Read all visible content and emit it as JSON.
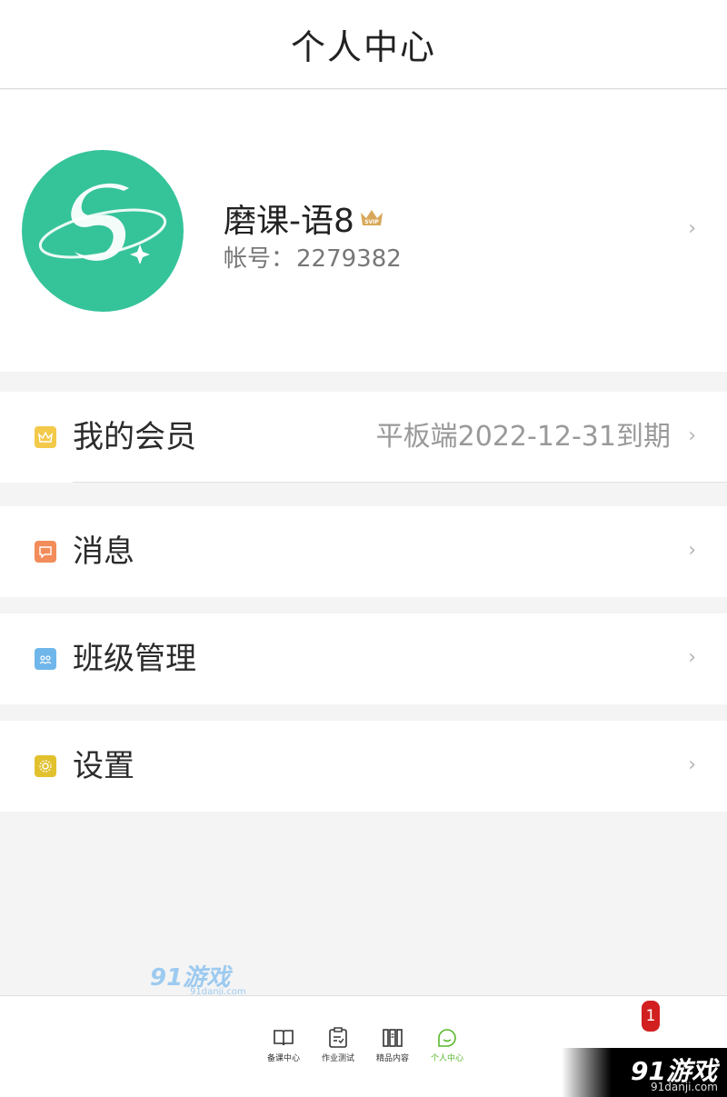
{
  "header": {
    "title": "个人中心"
  },
  "profile": {
    "name": "磨课-语8",
    "vip_badge": "SVIP",
    "account_label": "帐号：",
    "account_number": "2279382"
  },
  "menu": [
    {
      "label": "我的会员",
      "value": "平板端2022-12-31到期",
      "icon": "crown-icon",
      "color": "#f3c94a"
    },
    {
      "label": "消息",
      "value": "",
      "icon": "message-icon",
      "color": "#f28c5a"
    },
    {
      "label": "班级管理",
      "value": "",
      "icon": "class-icon",
      "color": "#6fb6ea"
    },
    {
      "label": "设置",
      "value": "",
      "icon": "gear-icon",
      "color": "#e2c12f"
    }
  ],
  "tabs": [
    {
      "label": "备课中心",
      "icon": "book-icon",
      "active": false
    },
    {
      "label": "作业测试",
      "icon": "clipboard-icon",
      "active": false
    },
    {
      "label": "精品内容",
      "icon": "library-icon",
      "active": false
    },
    {
      "label": "个人中心",
      "icon": "smile-icon",
      "active": true
    }
  ],
  "badge_count": "1",
  "watermark": {
    "text": "91游戏",
    "sub": "91danji.com"
  },
  "colors": {
    "accent": "#59b82b",
    "avatar_bg": "#35c39a",
    "badge": "#d21f1f"
  }
}
